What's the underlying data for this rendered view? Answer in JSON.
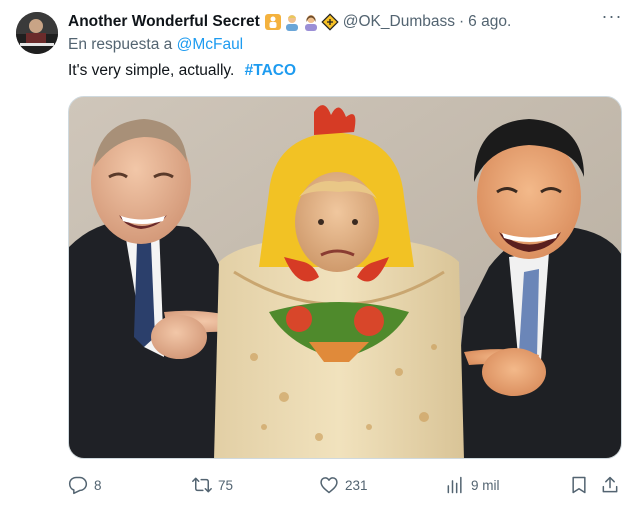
{
  "author": {
    "display_name": "Another Wonderful Secret",
    "handle": "@OK_Dumbass",
    "separator": "·",
    "time": "6 ago.",
    "badges": [
      "family-emoji-icon",
      "man-icon",
      "woman-icon",
      "diamond-icon"
    ]
  },
  "reply_context": {
    "prefix": "En respuesta a",
    "mention": "@McFaul"
  },
  "tweet": {
    "text": "It's very simple, actually.",
    "hashtag": "#TACO"
  },
  "actions": {
    "replies": "8",
    "reposts": "75",
    "likes": "231",
    "views": "9 mil"
  },
  "colors": {
    "link": "#1d9bf0",
    "secondary_text": "#536471",
    "primary_text": "#0f1419"
  }
}
